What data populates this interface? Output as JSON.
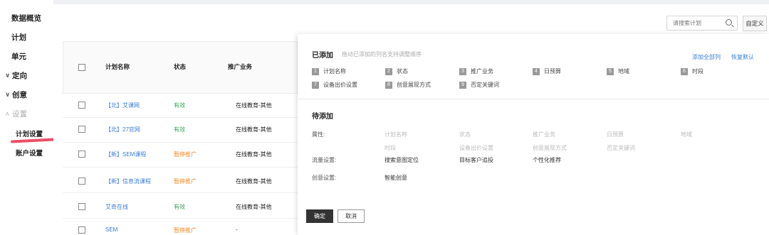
{
  "sidebar": {
    "items": [
      {
        "label": "数据概览"
      },
      {
        "label": "计划"
      },
      {
        "label": "单元"
      },
      {
        "label": "定向"
      },
      {
        "label": "创意"
      },
      {
        "label": "设置"
      }
    ],
    "sub_items": [
      {
        "label": "计划设置"
      },
      {
        "label": "账户设置"
      }
    ]
  },
  "toolbar": {
    "search_placeholder": "请搜索计划",
    "custom_label": "自定义"
  },
  "table": {
    "headers": [
      "计划名称",
      "状态",
      "推广业务"
    ],
    "rows": [
      {
        "name": "【北】艾课网",
        "status": "有效",
        "business": "在线教育-其他"
      },
      {
        "name": "【北】27官网",
        "status": "有效",
        "business": "在线教育-其他"
      },
      {
        "name": "【新】SEM课程",
        "status": "暂停推广",
        "business": "在线教育-其他"
      },
      {
        "name": "【新】信息流课程",
        "status": "暂停推广",
        "business": "在线教育-其他"
      },
      {
        "name": "艾奇在线",
        "status": "有效",
        "business": "在线教育-其他"
      },
      {
        "name": "SEM",
        "status": "暂停推广",
        "business": "-"
      }
    ]
  },
  "panel": {
    "added_title": "已添加",
    "added_hint": "拖动已添加的列名支持调整顺序",
    "add_all_label": "添加全部列",
    "restore_default_label": "恢复默认",
    "added_items": [
      {
        "num": "1",
        "label": "计划名称"
      },
      {
        "num": "2",
        "label": "状态"
      },
      {
        "num": "3",
        "label": "推广业务"
      },
      {
        "num": "4",
        "label": "日预算"
      },
      {
        "num": "5",
        "label": "地域"
      },
      {
        "num": "6",
        "label": "时段"
      },
      {
        "num": "7",
        "label": "设备出价设置"
      },
      {
        "num": "8",
        "label": "创意展现方式"
      },
      {
        "num": "9",
        "label": "否定关键词"
      }
    ],
    "pending_title": "待添加",
    "rows": {
      "attributes_label": "属性:",
      "attributes": [
        "计划名称",
        "状态",
        "推广业务",
        "日预算",
        "地域",
        "时段",
        "设备出价设置",
        "创意展现方式",
        "否定关键词"
      ],
      "traffic_label": "流量设置:",
      "traffic": [
        "搜索意图定位",
        "目标客户追投",
        "个性化推荐"
      ],
      "creative_label": "创意设置:",
      "creative": [
        "智能创意"
      ]
    },
    "confirm_label": "确定",
    "cancel_label": "取消"
  }
}
